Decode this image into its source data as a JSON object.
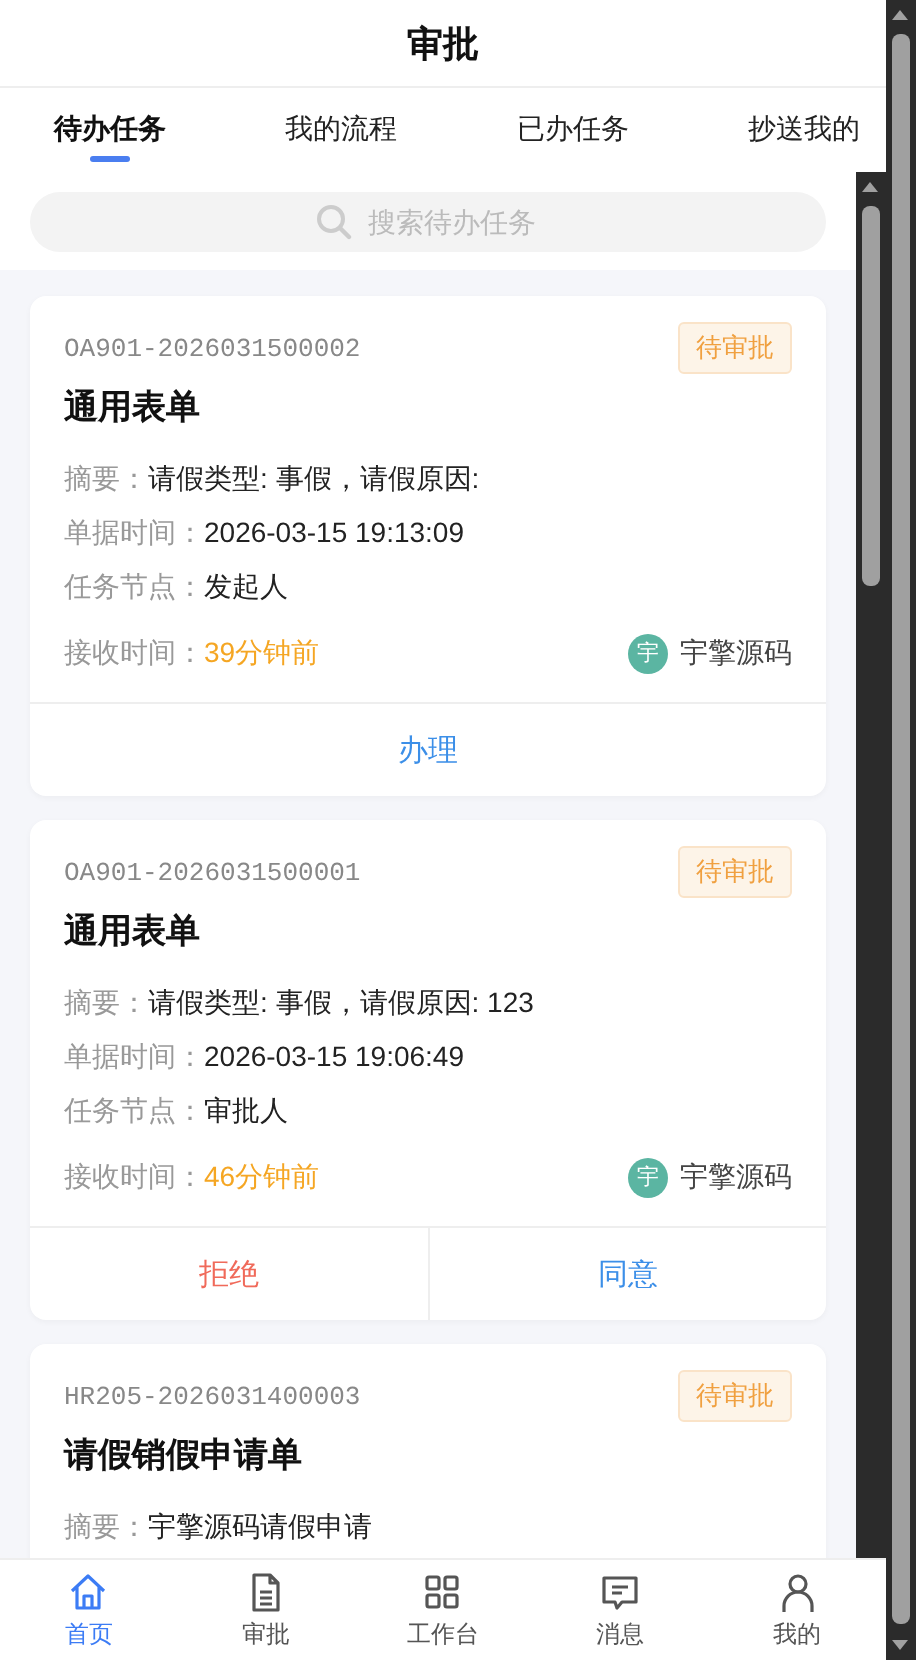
{
  "header": {
    "title": "审批"
  },
  "tabs": [
    {
      "label": "待办任务",
      "selected": true
    },
    {
      "label": "我的流程",
      "selected": false
    },
    {
      "label": "已办任务",
      "selected": false
    },
    {
      "label": "抄送我的",
      "selected": false
    }
  ],
  "search": {
    "placeholder": "搜索待办任务"
  },
  "tasks": [
    {
      "number": "OA901-2026031500002",
      "status": "待审批",
      "title": "通用表单",
      "fields": [
        {
          "label": "摘要：",
          "value": "请假类型: 事假，请假原因:"
        },
        {
          "label": "单据时间：",
          "value": "2026-03-15 19:13:09"
        },
        {
          "label": "任务节点：",
          "value": "发起人"
        }
      ],
      "received_label": "接收时间：",
      "received": "39分钟前",
      "avatar": "宇",
      "user": "宇擎源码",
      "actions": [
        {
          "label": "办理",
          "kind": "primary"
        }
      ]
    },
    {
      "number": "OA901-2026031500001",
      "status": "待审批",
      "title": "通用表单",
      "fields": [
        {
          "label": "摘要：",
          "value": "请假类型: 事假，请假原因: 123"
        },
        {
          "label": "单据时间：",
          "value": "2026-03-15 19:06:49"
        },
        {
          "label": "任务节点：",
          "value": "审批人"
        }
      ],
      "received_label": "接收时间：",
      "received": "46分钟前",
      "avatar": "宇",
      "user": "宇擎源码",
      "actions": [
        {
          "label": "拒绝",
          "kind": "danger"
        },
        {
          "label": "同意",
          "kind": "primary"
        }
      ]
    },
    {
      "number": "HR205-2026031400003",
      "status": "待审批",
      "title": "请假销假申请单",
      "fields": [
        {
          "label": "摘要：",
          "value": "宇擎源码请假申请"
        }
      ]
    }
  ],
  "nav": [
    {
      "label": "首页",
      "kind": "home",
      "selected": true
    },
    {
      "label": "审批",
      "kind": "document",
      "selected": false
    },
    {
      "label": "工作台",
      "kind": "grid",
      "selected": false
    },
    {
      "label": "消息",
      "kind": "message",
      "selected": false
    },
    {
      "label": "我的",
      "kind": "user",
      "selected": false
    }
  ]
}
